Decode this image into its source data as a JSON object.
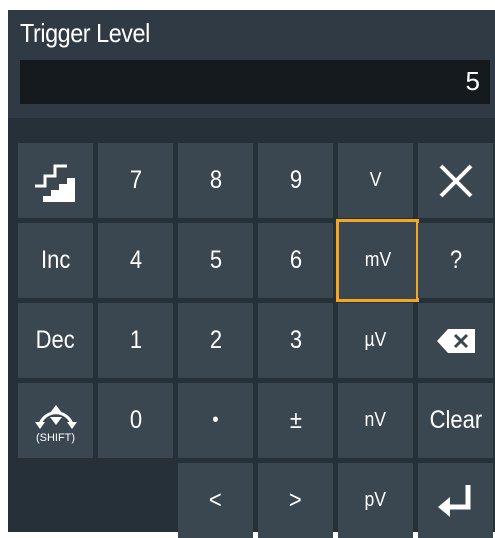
{
  "dialog": {
    "title": "Trigger Level",
    "value": "5"
  },
  "keys": {
    "row1": [
      "",
      "7",
      "8",
      "9",
      "V",
      ""
    ],
    "row2": [
      "Inc",
      "4",
      "5",
      "6",
      "mV",
      "?"
    ],
    "row3": [
      "Dec",
      "1",
      "2",
      "3",
      "µV",
      ""
    ],
    "row4": [
      "",
      "0",
      "•",
      "±",
      "nV",
      "Clear"
    ],
    "row5": [
      "<",
      ">",
      "pV",
      ""
    ]
  },
  "shift_label": "(SHIFT)",
  "selected_key": "mV",
  "colors": {
    "panel": "#2f3a44",
    "keypad_bg": "#253038",
    "key": "#3a4650",
    "display": "#151a1f",
    "highlight": "#f5a623"
  },
  "icons": {
    "step_key": "stairs-icon",
    "close_key": "close-icon",
    "backspace_key": "backspace-icon",
    "shift_key": "shift-rotate-icon",
    "enter_key": "enter-icon"
  }
}
